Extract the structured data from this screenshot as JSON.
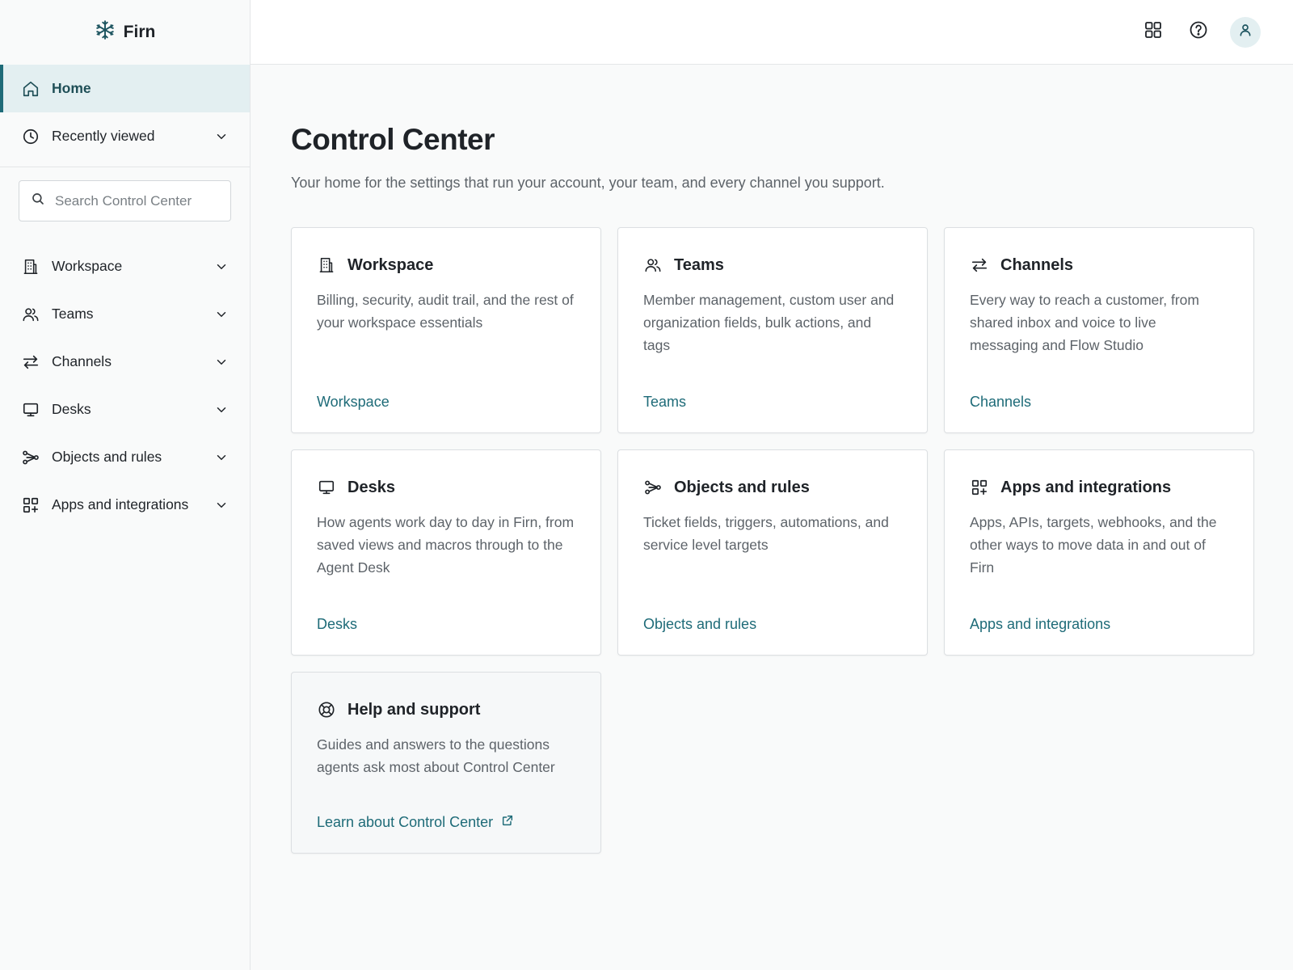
{
  "brand": {
    "name": "Firn",
    "icon": "snowflake-icon"
  },
  "sidebar": {
    "top_items": [
      {
        "label": "Home",
        "icon": "home-icon",
        "active": true
      },
      {
        "label": "Recently viewed",
        "icon": "clock-icon",
        "active": false
      }
    ],
    "search": {
      "placeholder": "Search Control Center"
    },
    "groups": [
      {
        "label": "Workspace",
        "icon": "building-icon"
      },
      {
        "label": "Teams",
        "icon": "users-icon"
      },
      {
        "label": "Channels",
        "icon": "arrows-exchange-icon"
      },
      {
        "label": "Desks",
        "icon": "monitor-icon"
      },
      {
        "label": "Objects and rules",
        "icon": "flow-icon"
      },
      {
        "label": "Apps and integrations",
        "icon": "apps-icon"
      }
    ]
  },
  "topbar": {
    "icons": [
      "app-grid-icon",
      "help-icon",
      "user-icon"
    ]
  },
  "main": {
    "title": "Control Center",
    "subtitle": "Your home for the settings that run your account, your team, and every channel you support.",
    "cards": [
      {
        "title": "Workspace",
        "icon": "building-icon",
        "description": "Billing, security, audit trail, and the rest of your workspace essentials",
        "link": "Workspace"
      },
      {
        "title": "Teams",
        "icon": "users-icon",
        "description": "Member management, custom user and organization fields, bulk actions, and tags",
        "link": "Teams"
      },
      {
        "title": "Channels",
        "icon": "arrows-exchange-icon",
        "description": "Every way to reach a customer, from shared inbox and voice to live messaging and Flow Studio",
        "link": "Channels"
      },
      {
        "title": "Desks",
        "icon": "monitor-icon",
        "description": "How agents work day to day in Firn, from saved views and macros through to the Agent Desk",
        "link": "Desks"
      },
      {
        "title": "Objects and rules",
        "icon": "flow-icon",
        "description": "Ticket fields, triggers, automations, and service level targets",
        "link": "Objects and rules"
      },
      {
        "title": "Apps and integrations",
        "icon": "apps-icon",
        "description": "Apps, APIs, targets, webhooks, and the other ways to move data in and out of Firn",
        "link": "Apps and integrations"
      },
      {
        "title": "Help and support",
        "icon": "lifebuoy-icon",
        "description": "Guides and answers to the questions agents ask most about Control Center",
        "link": "Learn about Control Center",
        "external": true
      }
    ]
  },
  "colors": {
    "accent": "#1e6b78",
    "active_bg": "#e3eff1",
    "text": "#1f2328",
    "muted_text": "#5d6369"
  }
}
